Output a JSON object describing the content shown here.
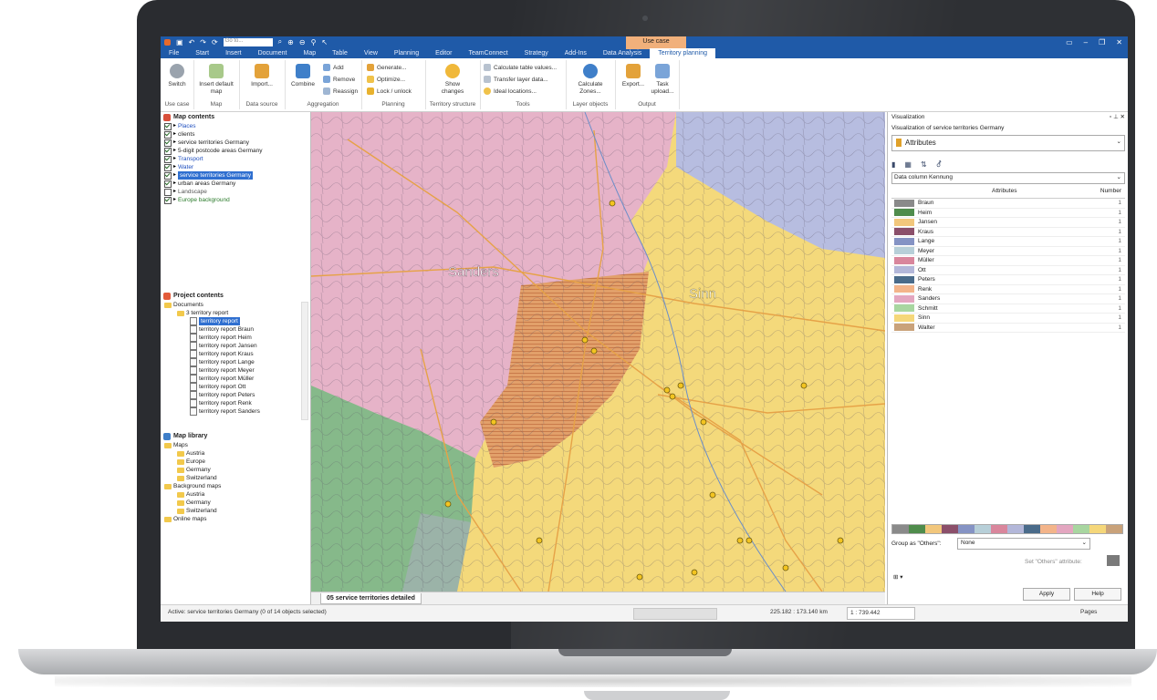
{
  "qat": {
    "goto_placeholder": "Go to..."
  },
  "ribbon_tabs": [
    "File",
    "Start",
    "Insert",
    "Document",
    "Map",
    "Table",
    "View",
    "Planning",
    "Editor",
    "TeamConnect",
    "Strategy",
    "Add-Ins",
    "Data Analysis",
    "Territory planning"
  ],
  "active_tab": "Territory planning",
  "context_tab": "Use case",
  "ribbon": {
    "use_case": {
      "switch": "Switch",
      "group": "Use case"
    },
    "map": {
      "insert_default_map": "Insert default map",
      "group": "Map"
    },
    "data_source": {
      "import": "Import...",
      "group": "Data source"
    },
    "aggregation": {
      "combine": "Combine",
      "add": "Add",
      "remove": "Remove",
      "reassign": "Reassign",
      "group": "Aggregation"
    },
    "planning": {
      "generate": "Generate...",
      "optimize": "Optimize...",
      "lock_unlock": "Lock / unlock",
      "group": "Planning"
    },
    "territory_structure": {
      "show_changes": "Show changes",
      "group": "Territory structure"
    },
    "tools": {
      "calc_table_values": "Calculate table values...",
      "transfer_layer": "Transfer layer data...",
      "ideal_locations": "Ideal locations...",
      "group": "Tools"
    },
    "layer_objects": {
      "calc_zones": "Calculate Zones...",
      "group": "Layer objects"
    },
    "output": {
      "export": "Export...",
      "task_upload": "Task upload...",
      "group": "Output"
    }
  },
  "map_contents": {
    "title": "Map contents",
    "layers": [
      {
        "label": "Places",
        "checked": true,
        "color": "#1f4fbf"
      },
      {
        "label": "clients",
        "checked": true,
        "color": "#222222"
      },
      {
        "label": "service territories Germany",
        "checked": true,
        "color": "#222222"
      },
      {
        "label": "5-digit postcode areas Germany",
        "checked": true,
        "color": "#222222"
      },
      {
        "label": "Transport",
        "checked": true,
        "color": "#1f4fbf"
      },
      {
        "label": "Water",
        "checked": true,
        "color": "#1f4fbf"
      },
      {
        "label": "service territories Germany",
        "checked": true,
        "color": "#ffffff",
        "selected": true
      },
      {
        "label": "urban areas Germany",
        "checked": true,
        "color": "#222222"
      },
      {
        "label": "Landscape",
        "checked": false,
        "color": "#555555"
      },
      {
        "label": "Europe background",
        "checked": true,
        "color": "#2a7a2a"
      }
    ]
  },
  "project_contents": {
    "title": "Project contents",
    "items": [
      {
        "label": "Documents",
        "level": 0,
        "type": "folder"
      },
      {
        "label": "3 territory report",
        "level": 1,
        "type": "folder"
      },
      {
        "label": "territory report",
        "level": 2,
        "type": "doc",
        "selected": true
      },
      {
        "label": "territory report Braun",
        "level": 2,
        "type": "doc"
      },
      {
        "label": "territory report Heim",
        "level": 2,
        "type": "doc"
      },
      {
        "label": "territory report Jansen",
        "level": 2,
        "type": "doc"
      },
      {
        "label": "territory report Kraus",
        "level": 2,
        "type": "doc"
      },
      {
        "label": "territory report Lange",
        "level": 2,
        "type": "doc"
      },
      {
        "label": "territory report Meyer",
        "level": 2,
        "type": "doc"
      },
      {
        "label": "territory report Müller",
        "level": 2,
        "type": "doc"
      },
      {
        "label": "territory report Ott",
        "level": 2,
        "type": "doc"
      },
      {
        "label": "territory report Peters",
        "level": 2,
        "type": "doc"
      },
      {
        "label": "territory report Renk",
        "level": 2,
        "type": "doc"
      },
      {
        "label": "territory report Sanders",
        "level": 2,
        "type": "doc"
      }
    ]
  },
  "map_library": {
    "title": "Map library",
    "items": [
      {
        "label": "Maps",
        "level": 0
      },
      {
        "label": "Austria",
        "level": 1
      },
      {
        "label": "Europe",
        "level": 1
      },
      {
        "label": "Germany",
        "level": 1
      },
      {
        "label": "Switzerland",
        "level": 1
      },
      {
        "label": "Background maps",
        "level": 0
      },
      {
        "label": "Austria",
        "level": 1
      },
      {
        "label": "Germany",
        "level": 1
      },
      {
        "label": "Switzerland",
        "level": 1
      },
      {
        "label": "Online maps",
        "level": 0
      }
    ]
  },
  "map": {
    "labels": {
      "sanders": "Sanders",
      "sinn": "Sinn"
    },
    "tab": "05 service territories detailed"
  },
  "visualization": {
    "title": "Visualization",
    "subtitle": "Visualization of service territories Germany",
    "mode": "Attributes",
    "data_column_label": "Data column",
    "data_column_value": "Kennung",
    "col_attributes": "Attributes",
    "col_number": "Number",
    "rows": [
      {
        "name": "Braun",
        "color": "#8a8a8a",
        "count": "1"
      },
      {
        "name": "Heim",
        "color": "#4f8c4c",
        "count": "1"
      },
      {
        "name": "Jansen",
        "color": "#f2c77c",
        "count": "1"
      },
      {
        "name": "Kraus",
        "color": "#8b4f6a",
        "count": "1"
      },
      {
        "name": "Lange",
        "color": "#8593c4",
        "count": "1"
      },
      {
        "name": "Meyer",
        "color": "#b7cfd8",
        "count": "1"
      },
      {
        "name": "Müller",
        "color": "#d9869c",
        "count": "1"
      },
      {
        "name": "Ott",
        "color": "#b3b7d9",
        "count": "1"
      },
      {
        "name": "Peters",
        "color": "#4a6b8a",
        "count": "1"
      },
      {
        "name": "Renk",
        "color": "#f3b48a",
        "count": "1"
      },
      {
        "name": "Sanders",
        "color": "#e3a6c0",
        "count": "1"
      },
      {
        "name": "Schmitt",
        "color": "#a8d6a0",
        "count": "1"
      },
      {
        "name": "Sinn",
        "color": "#f5d77a",
        "count": "1"
      },
      {
        "name": "Walter",
        "color": "#c9a27a",
        "count": "1"
      }
    ],
    "group_others_label": "Group as \"Others\":",
    "group_others_value": "None",
    "set_others_label": "Set \"Others\" attribute:",
    "apply": "Apply",
    "help": "Help"
  },
  "status": {
    "active": "Active: service territories Germany (0 of 14 objects selected)",
    "dimensions": "225.182 : 173.140 km",
    "scale": "1 : 739.442",
    "pages": "Pages"
  }
}
